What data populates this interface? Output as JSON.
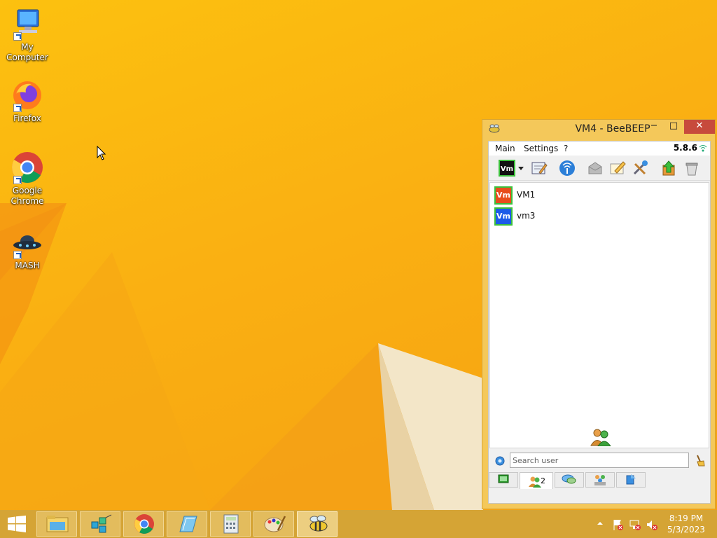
{
  "desktop": {
    "icons": [
      {
        "label": "My Computer"
      },
      {
        "label": "Firefox"
      },
      {
        "label": "Google Chrome"
      },
      {
        "label": "MASH"
      }
    ]
  },
  "window": {
    "title": "VM4 - BeeBEEP",
    "minimize": "−",
    "maximize": "□",
    "close": "✕",
    "menu": [
      "Main",
      "Settings",
      "?"
    ],
    "version": "5.8.6",
    "users": [
      {
        "badge": "Vm",
        "name": "VM1",
        "color": "#e84d1c"
      },
      {
        "badge": "Vm",
        "name": "vm3",
        "color": "#1c5be8"
      }
    ],
    "search_placeholder": "Search user",
    "users_tab_count": "2"
  },
  "taskbar": {
    "clock_time": "8:19 PM",
    "clock_date": "5/3/2023"
  },
  "colors": {
    "wallpaper": "#f8b311",
    "close_button": "#c74a3c",
    "online_border": "#3cbf3c"
  }
}
